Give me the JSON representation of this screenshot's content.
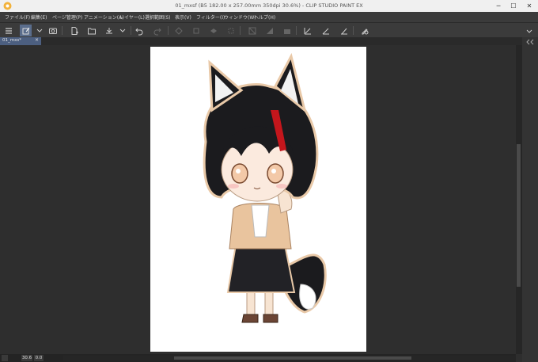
{
  "window": {
    "title": "01_mxsf (B5 182.00 x 257.00mm 350dpi 30.6%)  - CLIP STUDIO PAINT EX"
  },
  "menu": [
    "ファイル(F)",
    "編集(E)",
    "ページ管理(P)",
    "アニメーション(A)",
    "レイヤー(L)",
    "選択範囲(S)",
    "表示(V)",
    "フィルター(I)",
    "ウィンドウ(W)",
    "ヘルプ(H)"
  ],
  "tab": {
    "label": "01_mxs*",
    "close": "×"
  },
  "status": {
    "zoom": "30.6",
    "angle": "0.0"
  },
  "colors": {
    "accent": "#5a6d8c",
    "tab_active": "#4c5f80",
    "background": "#2e2e2e",
    "paper": "#ffffff"
  },
  "icons": [
    "menu-icon",
    "pen-icon",
    "chevron-down-icon",
    "camera-icon",
    "new-file-icon",
    "open-folder-icon",
    "save-icon",
    "chevron-down-icon",
    "undo-icon",
    "redo-icon",
    "transform-icon",
    "fill-icon",
    "settings-icon"
  ]
}
